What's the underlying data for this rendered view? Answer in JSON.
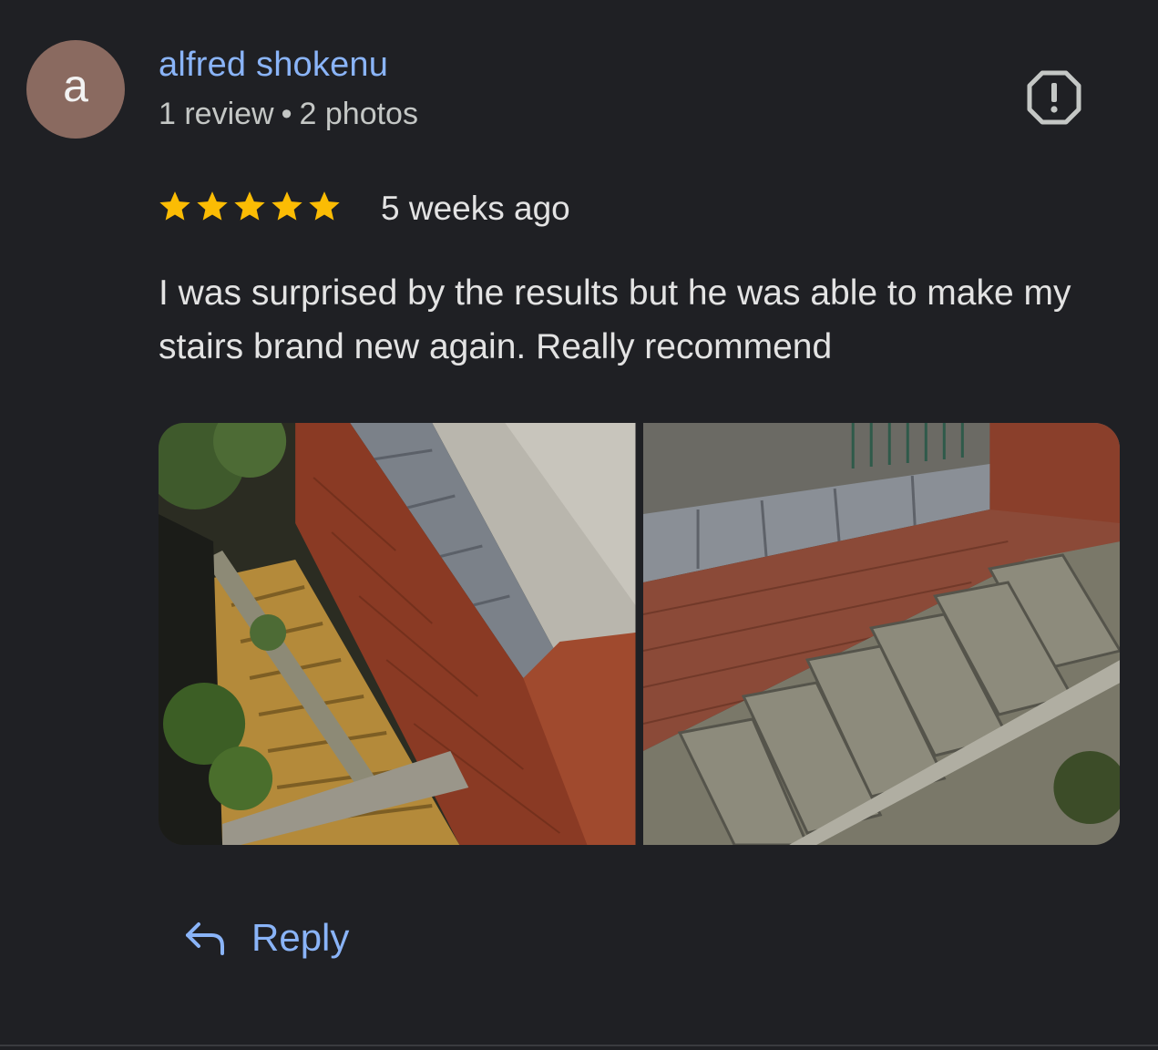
{
  "review": {
    "avatar_letter": "a",
    "author_name": "alfred shokenu",
    "author_meta": {
      "reviews": "1 review",
      "separator": "•",
      "photos": "2 photos"
    },
    "rating": 5,
    "rating_max": 5,
    "time_ago": "5 weeks ago",
    "text": "I was surprised by the results but he was able to make my stairs brand new again. Really recommend",
    "photo_count": 2,
    "reply_label": "Reply"
  },
  "colors": {
    "background": "#1f2024",
    "link": "#8ab4f8",
    "star": "#fbbc04",
    "avatar": "#8a6a60",
    "text": "#e3e3e3",
    "muted": "#c4c7c5"
  },
  "icons": {
    "report": "report-flag-icon",
    "reply": "reply-arrow-icon",
    "star": "star-icon"
  }
}
